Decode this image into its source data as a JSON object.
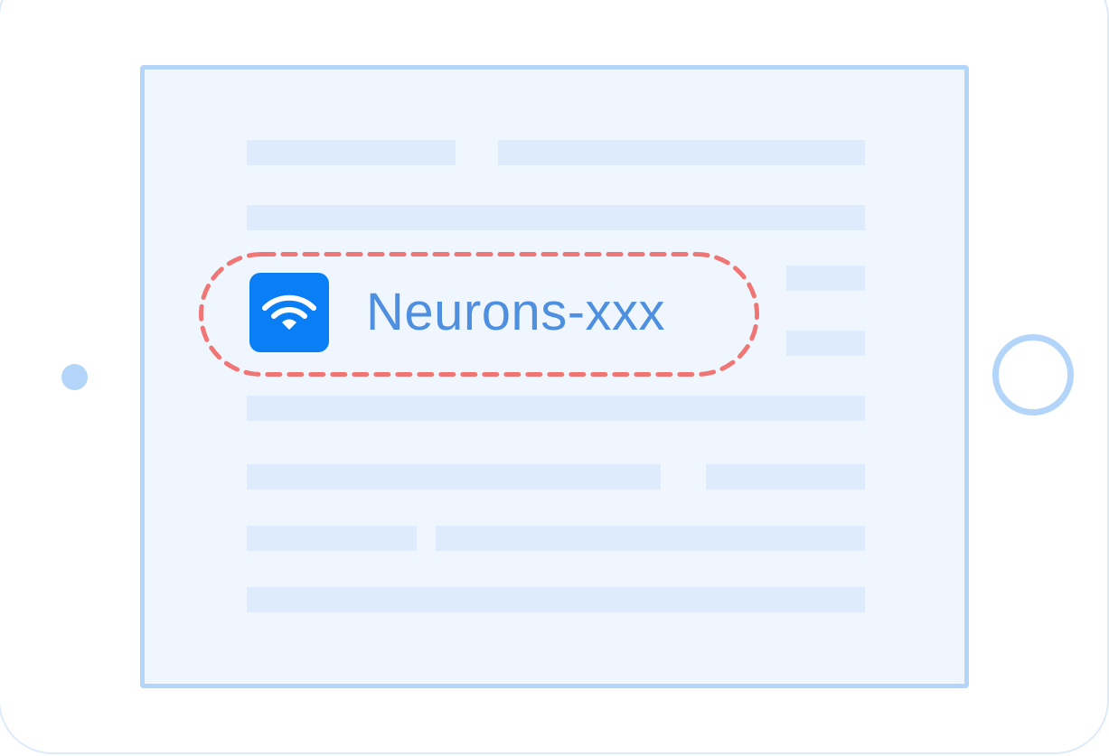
{
  "network": {
    "ssid": "Neurons-xxx",
    "icon": "wifi-icon",
    "highlight": "dashed-outline"
  },
  "colors": {
    "screen_background": "#eff6fe",
    "device_frame": "#b3d5fa",
    "placeholder_bar": "#deebfc",
    "wifi_badge": "#0a7ff5",
    "ssid_text": "#4e8fe0",
    "highlight_dash": "#f07575"
  }
}
